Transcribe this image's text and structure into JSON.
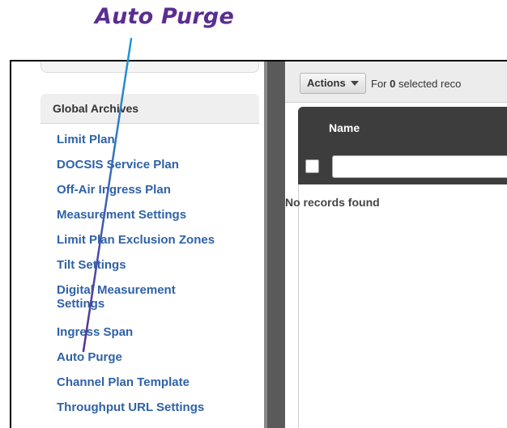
{
  "callout": {
    "text": "Auto Purge"
  },
  "sidebar": {
    "section_title": "Global Archives",
    "items": [
      {
        "label": "Limit Plan",
        "lines": 1
      },
      {
        "label": "DOCSIS Service Plan",
        "lines": 1
      },
      {
        "label": "Off-Air Ingress Plan",
        "lines": 1
      },
      {
        "label": "Measurement Settings",
        "lines": 1
      },
      {
        "label": "Limit Plan Exclusion Zones",
        "lines": 1
      },
      {
        "label": "Tilt Settings",
        "lines": 1
      },
      {
        "label": "Digital Measurement Settings",
        "lines": 2
      },
      {
        "label": "Ingress Span",
        "lines": 1
      },
      {
        "label": "Auto Purge",
        "lines": 1
      },
      {
        "label": "Channel Plan Template",
        "lines": 1
      },
      {
        "label": "Throughput URL Settings",
        "lines": 1
      }
    ]
  },
  "toolbar": {
    "actions_label": "Actions",
    "selected_prefix": "For",
    "selected_count": "0",
    "selected_suffix": "selected reco"
  },
  "grid": {
    "column_name": "Name",
    "empty_text": "No records found"
  },
  "colors": {
    "callout": "#5a2d91",
    "link": "#2f62a6",
    "header_bg": "#3d3d3d",
    "pointer_start": "#1e9ad6",
    "pointer_end": "#5a2d91"
  }
}
